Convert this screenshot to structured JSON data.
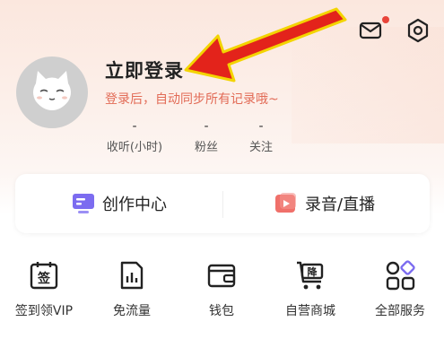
{
  "header": {
    "icons": [
      "mail-icon",
      "settings-icon"
    ],
    "notification_dot_color": "#e8443a"
  },
  "profile": {
    "title": "立即登录",
    "subtitle": "登录后，自动同步所有记录哦~",
    "stats": [
      {
        "value": "-",
        "label": "收听(小时)"
      },
      {
        "value": "-",
        "label": "粉丝"
      },
      {
        "value": "-",
        "label": "关注"
      }
    ]
  },
  "card": {
    "items": [
      {
        "label": "创作中心",
        "icon": "creator-center-icon"
      },
      {
        "label": "录音/直播",
        "icon": "record-live-icon"
      }
    ]
  },
  "quick_actions": [
    {
      "label": "签到领VIP",
      "icon": "sign-in-icon",
      "badge": "签"
    },
    {
      "label": "免流量",
      "icon": "free-data-icon"
    },
    {
      "label": "钱包",
      "icon": "wallet-icon"
    },
    {
      "label": "自营商城",
      "icon": "mall-cart-icon",
      "badge": "降"
    },
    {
      "label": "全部服务",
      "icon": "all-services-icon"
    }
  ],
  "colors": {
    "accent": "#e26b56",
    "arrow": "#e3231b",
    "arrow_outline": "#f3d400"
  }
}
